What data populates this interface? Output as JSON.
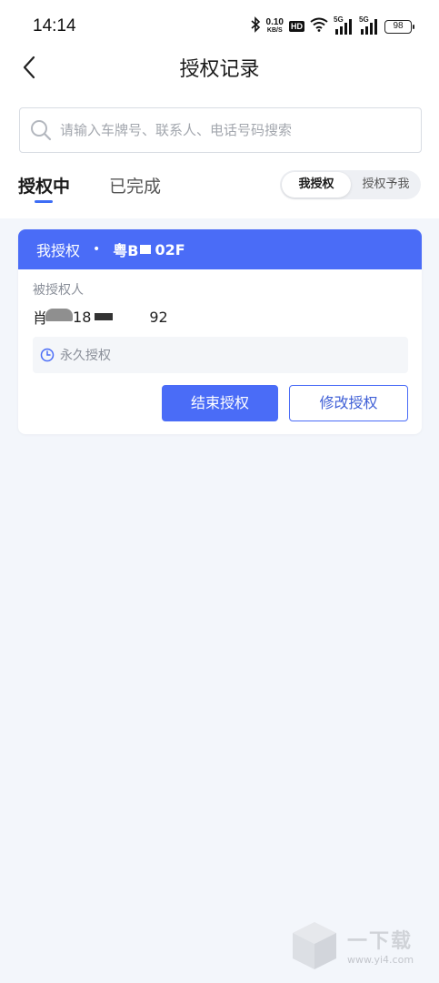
{
  "status_bar": {
    "time": "14:14",
    "net_speed_value": "0.10",
    "net_speed_unit": "KB/S",
    "hd_label": "HD",
    "signal1_tag": "5G",
    "signal2_tag": "5G",
    "battery": "98"
  },
  "nav": {
    "title": "授权记录",
    "back_icon": "chevron-left-icon"
  },
  "search": {
    "placeholder": "请输入车牌号、联系人、电话号码搜索",
    "value": ""
  },
  "tabs": [
    {
      "label": "授权中",
      "active": true
    },
    {
      "label": "已完成",
      "active": false
    }
  ],
  "segment": [
    {
      "label": "我授权",
      "active": true
    },
    {
      "label": "授权予我",
      "active": false
    }
  ],
  "card": {
    "header_label": "我授权",
    "separator": "•",
    "plate_prefix": "粤B",
    "plate_suffix": "02F",
    "grantee_label": "被授权人",
    "grantee_name": "肖",
    "grantee_phone_prefix": "18",
    "grantee_phone_suffix": "92",
    "validity": "永久授权",
    "end_button": "结束授权",
    "edit_button": "修改授权"
  },
  "watermark": {
    "brand": "一下载",
    "site": "www.yi4.com"
  },
  "colors": {
    "accent": "#4a6cf7",
    "background": "#f3f6fb"
  }
}
